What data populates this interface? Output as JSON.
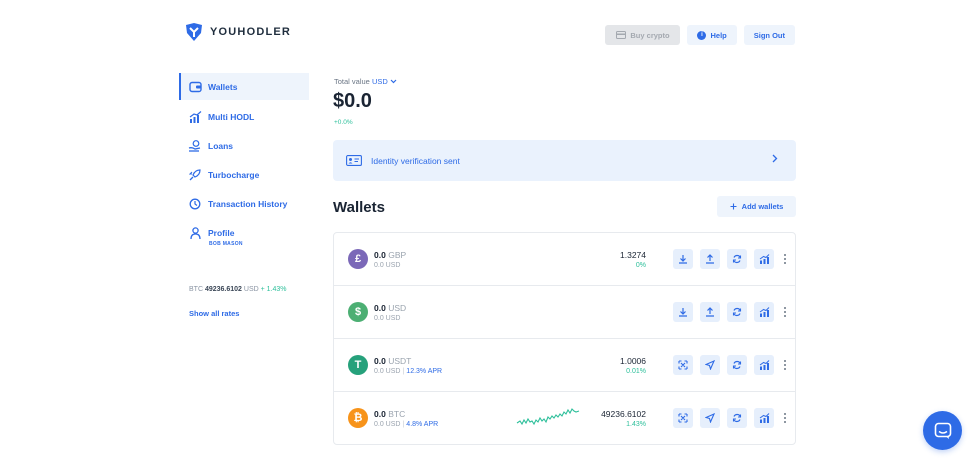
{
  "brand": {
    "name": "YOUHODLER"
  },
  "header": {
    "buy_crypto": "Buy crypto",
    "help": "Help",
    "sign_out": "Sign Out"
  },
  "sidebar": {
    "items": [
      {
        "label": "Wallets",
        "icon": "wallet-icon",
        "active": true
      },
      {
        "label": "Multi HODL",
        "icon": "bar-chart-icon"
      },
      {
        "label": "Loans",
        "icon": "hand-coin-icon"
      },
      {
        "label": "Turbocharge",
        "icon": "rocket-icon"
      },
      {
        "label": "Transaction History",
        "icon": "history-icon"
      },
      {
        "label": "Profile",
        "icon": "user-icon"
      }
    ],
    "profile_name": "BOB MASON",
    "rate": {
      "symbol": "BTC",
      "value": "49236.6102",
      "currency": "USD",
      "change": "+ 1.43%"
    },
    "show_rates": "Show all rates"
  },
  "summary": {
    "label": "Total value",
    "currency": "USD",
    "value": "$0.0",
    "change": "+0.0%"
  },
  "verification": {
    "text": "Identity verification sent",
    "icon": "id-card-icon"
  },
  "wallets": {
    "title": "Wallets",
    "add_label": "Add wallets",
    "rows": [
      {
        "amount": "0.0",
        "symbol": "GBP",
        "sub_value": "0.0 USD",
        "apr": "",
        "price": "1.3274",
        "change": "0%",
        "coin_color": "#7b68b8",
        "coin_glyph": "£",
        "icon": "pound-coin-icon",
        "actions": [
          "download-icon",
          "upload-icon",
          "exchange-icon",
          "multi-hodl-icon"
        ]
      },
      {
        "amount": "0.0",
        "symbol": "USD",
        "sub_value": "0.0 USD",
        "apr": "",
        "price": "",
        "change": "",
        "coin_color": "#4caf73",
        "coin_glyph": "$",
        "icon": "dollar-coin-icon",
        "actions": [
          "download-icon",
          "upload-icon",
          "exchange-icon",
          "multi-hodl-icon"
        ]
      },
      {
        "amount": "0.0",
        "symbol": "USDT",
        "sub_value": "0.0 USD",
        "apr": "12.3% APR",
        "price": "1.0006",
        "change": "0.01%",
        "coin_color": "#26a17b",
        "coin_glyph": "T",
        "icon": "tether-coin-icon",
        "actions": [
          "qr-icon",
          "send-icon",
          "exchange-icon",
          "multi-hodl-icon"
        ]
      },
      {
        "amount": "0.0",
        "symbol": "BTC",
        "sub_value": "0.0 USD",
        "apr": "4.8% APR",
        "price": "49236.6102",
        "change": "1.43%",
        "coin_color": "#f7931a",
        "coin_glyph": "₿",
        "icon": "bitcoin-coin-icon",
        "actions": [
          "qr-icon",
          "send-icon",
          "exchange-icon",
          "multi-hodl-icon"
        ]
      }
    ]
  },
  "colors": {
    "accent": "#2e6be6",
    "positive": "#2cbf9a",
    "light_bg": "#eef4fc"
  }
}
